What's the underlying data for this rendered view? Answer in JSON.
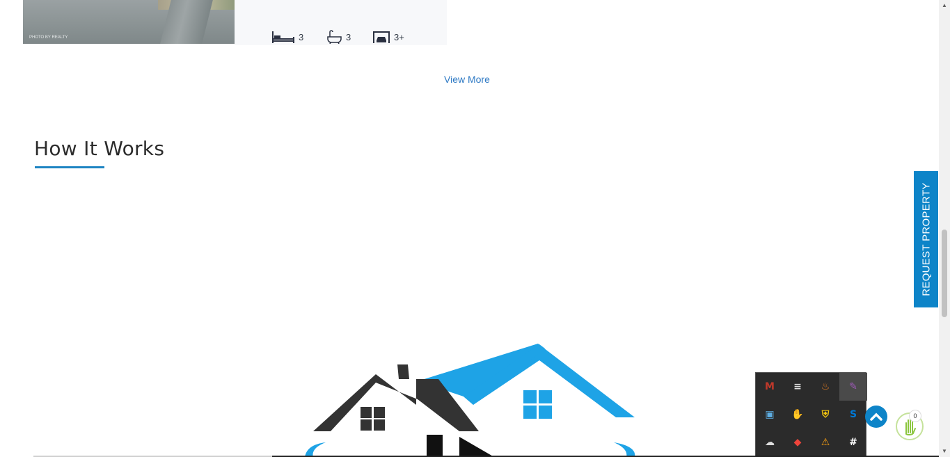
{
  "listing": {
    "photo_watermark": "PHOTO BY REALTY",
    "beds": "3",
    "baths": "3",
    "garage": "3+"
  },
  "view_more_label": "View More",
  "how_it_works": {
    "title": "How It Works"
  },
  "request_tab_label": "REQUEST PROPERTY",
  "hand_badge_count": "0",
  "tray": {
    "items": [
      {
        "icon": "mcafee-icon",
        "color": "#c0392b"
      },
      {
        "icon": "playlist-icon",
        "color": "#dddddd"
      },
      {
        "icon": "java-icon",
        "color": "#e67e22"
      },
      {
        "icon": "pen-icon",
        "color": "#9b59b6"
      },
      {
        "icon": "cube-icon",
        "color": "#5dade2"
      },
      {
        "icon": "hand-icon",
        "color": "#e74c3c"
      },
      {
        "icon": "security-shield-icon",
        "color": "#f1c40f"
      },
      {
        "icon": "skype-icon",
        "color": "#0078d4"
      },
      {
        "icon": "onedrive-icon",
        "color": "#dddddd"
      },
      {
        "icon": "anydesk-icon",
        "color": "#ef443b"
      },
      {
        "icon": "updater-icon",
        "color": "#f39c12"
      },
      {
        "icon": "slack-icon",
        "color": "#ffffff"
      }
    ]
  },
  "colors": {
    "accent": "#0d84c8",
    "link": "#2d79c4"
  }
}
